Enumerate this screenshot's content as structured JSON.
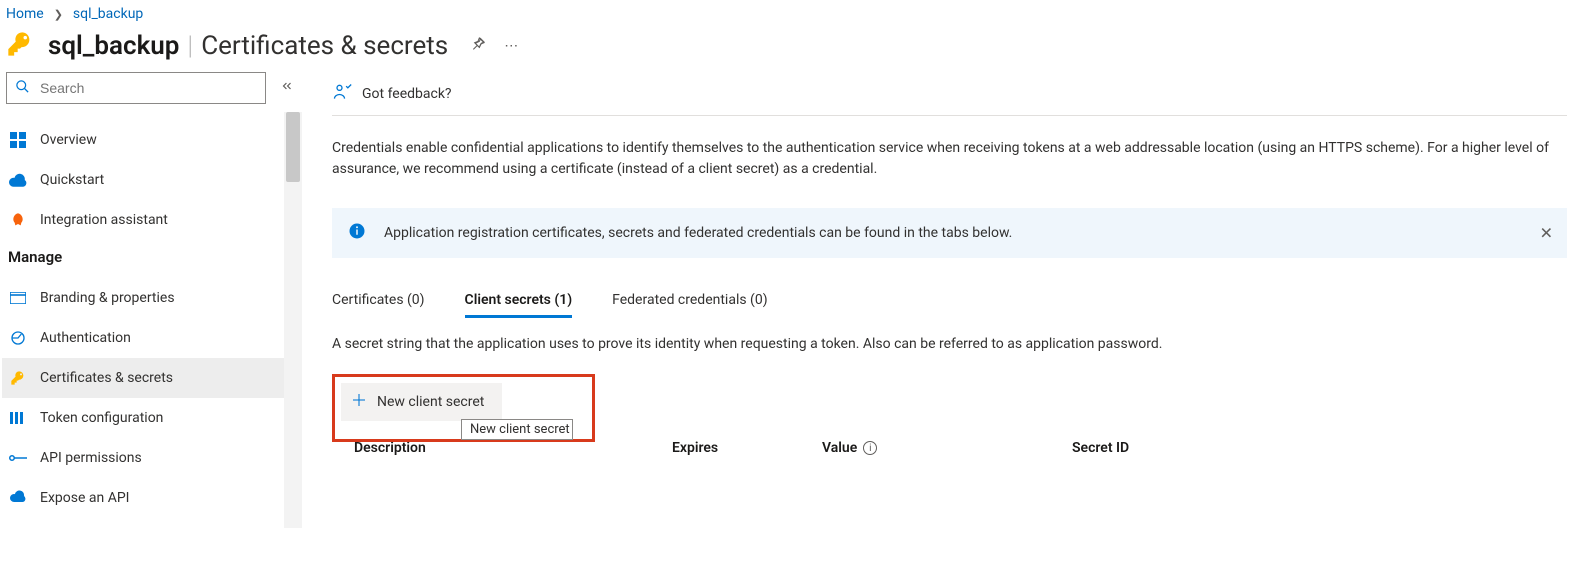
{
  "breadcrumb": {
    "home": "Home",
    "current": "sql_backup"
  },
  "title": {
    "app_name": "sql_backup",
    "page_name": "Certificates & secrets"
  },
  "search": {
    "placeholder": "Search"
  },
  "sidebar": {
    "top_items": [
      {
        "label": "Overview",
        "icon": "grid"
      },
      {
        "label": "Quickstart",
        "icon": "cloud"
      },
      {
        "label": "Integration assistant",
        "icon": "rocket"
      }
    ],
    "manage_heading": "Manage",
    "manage_items": [
      {
        "label": "Branding & properties",
        "icon": "branding"
      },
      {
        "label": "Authentication",
        "icon": "auth"
      },
      {
        "label": "Certificates & secrets",
        "icon": "key",
        "selected": true
      },
      {
        "label": "Token configuration",
        "icon": "token"
      },
      {
        "label": "API permissions",
        "icon": "api"
      },
      {
        "label": "Expose an API",
        "icon": "expose"
      }
    ]
  },
  "main": {
    "feedback_label": "Got feedback?",
    "intro": "Credentials enable confidential applications to identify themselves to the authentication service when receiving tokens at a web addressable location (using an HTTPS scheme). For a higher level of assurance, we recommend using a certificate (instead of a client secret) as a credential.",
    "banner": "Application registration certificates, secrets and federated credentials can be found in the tabs below.",
    "tabs": [
      {
        "label": "Certificates (0)"
      },
      {
        "label": "Client secrets (1)",
        "selected": true
      },
      {
        "label": "Federated credentials (0)"
      }
    ],
    "tab_desc": "A secret string that the application uses to prove its identity when requesting a token. Also can be referred to as application password.",
    "new_secret_label": "New client secret",
    "tooltip": "New client secret",
    "columns": {
      "description": "Description",
      "expires": "Expires",
      "value": "Value",
      "secret_id": "Secret ID"
    }
  }
}
